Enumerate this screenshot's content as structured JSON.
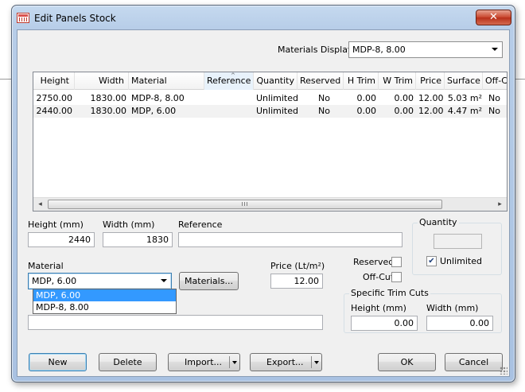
{
  "window": {
    "title": "Edit Panels Stock",
    "close_symbol": "✕"
  },
  "materials_display": {
    "label": "Materials Display",
    "value": "MDP-8, 8.00"
  },
  "grid": {
    "columns": [
      "Height",
      "Width",
      "Material",
      "Reference",
      "Quantity",
      "Reserved",
      "H Trim",
      "W Trim",
      "Price",
      "Surface",
      "Off-C"
    ],
    "rows": [
      [
        "2750.00",
        "1830.00",
        "MDP-8, 8.00",
        "",
        "Unlimited",
        "No",
        "0.00",
        "0.00",
        "12.00",
        "5.03 m²",
        "No"
      ],
      [
        "2440.00",
        "1830.00",
        "MDP, 6.00",
        "",
        "Unlimited",
        "No",
        "0.00",
        "0.00",
        "12.00",
        "4.47 m²",
        "No"
      ]
    ],
    "scroll_grip": "III"
  },
  "form": {
    "height_label": "Height (mm)",
    "height_value": "2440",
    "width_label": "Width (mm)",
    "width_value": "1830",
    "reference_label": "Reference",
    "reference_value": "",
    "quantity_label": "Quantity",
    "quantity_value": "",
    "unlimited_label": "Unlimited",
    "unlimited_checked": true,
    "material_label": "Material",
    "material_value": "MDP, 6.00",
    "materials_button": "Materials...",
    "price_label": "Price (Lt/m²)",
    "price_value": "12.00",
    "reserved_label": "Reserved",
    "reserved_checked": false,
    "offcut_label": "Off-Cut",
    "offcut_checked": false,
    "trim_group_label": "Specific Trim Cuts",
    "trim_height_label": "Height (mm)",
    "trim_height_value": "0.00",
    "trim_width_label": "Width (mm)",
    "trim_width_value": "0.00"
  },
  "material_dropdown": {
    "options": [
      "MDP, 6.00",
      "MDP-8, 8.00"
    ],
    "selected": "MDP, 6.00"
  },
  "buttons": {
    "new": "New",
    "delete": "Delete",
    "import": "Import...",
    "export": "Export...",
    "ok": "OK",
    "cancel": "Cancel"
  }
}
